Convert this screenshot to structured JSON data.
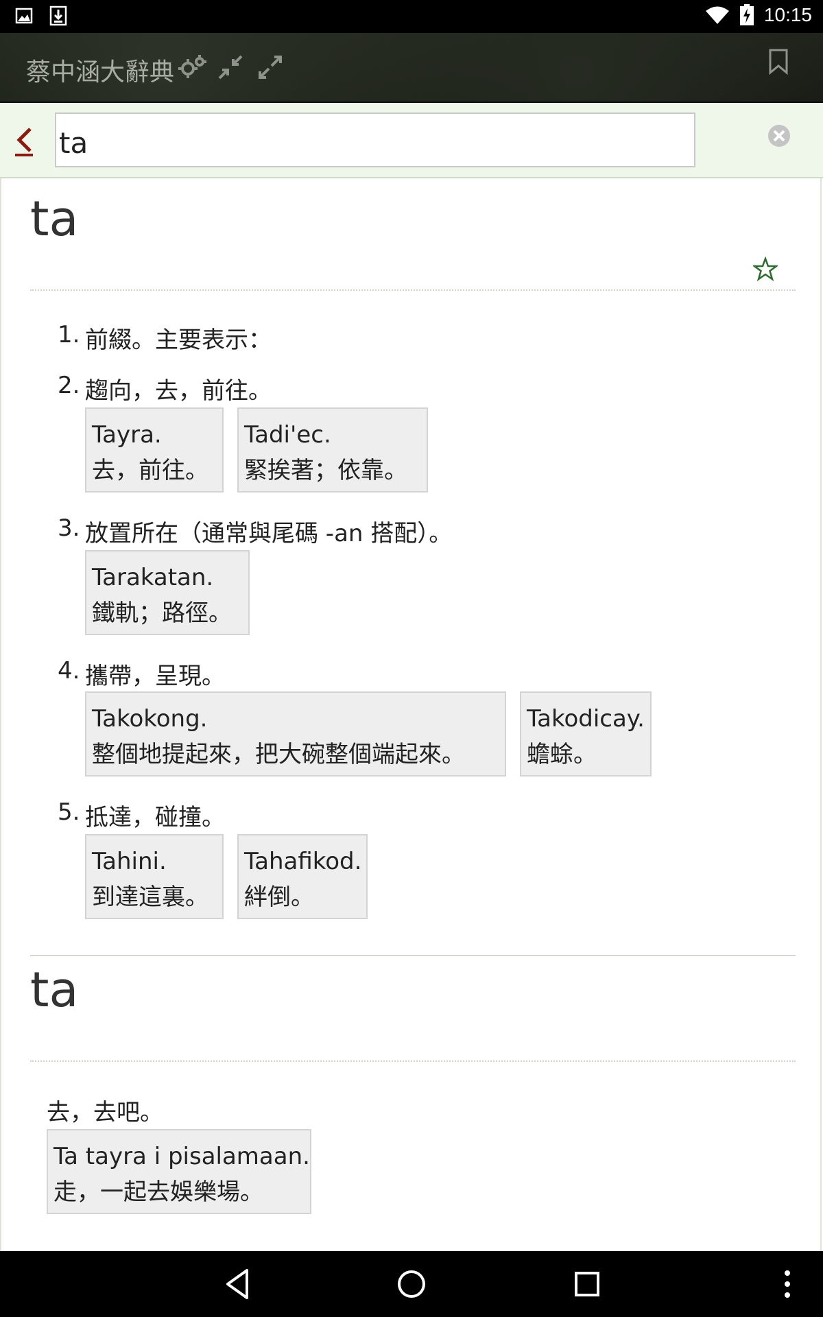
{
  "status_bar": {
    "time": "10:15",
    "icons": [
      "image-icon",
      "download-icon",
      "wifi-icon",
      "battery-charging-icon"
    ]
  },
  "app_bar": {
    "title": "蔡中涵大辭典",
    "icons": [
      "settings-icon",
      "collapse-icon",
      "expand-icon",
      "bookmark-icon"
    ]
  },
  "search": {
    "value": "ta",
    "back_icon": "back-chevron-icon",
    "clear_icon": "clear-icon"
  },
  "entries": [
    {
      "headword": "ta",
      "star_icon": "star-outline-icon",
      "definitions": [
        {
          "num": "1.",
          "text": "前綴。主要表示：",
          "examples": []
        },
        {
          "num": "2.",
          "text": "趨向，去，前往。",
          "examples": [
            {
              "src": "Tayra.",
              "tr": "去，前往。"
            },
            {
              "src": "Tadi'ec.",
              "tr": "緊挨著；依靠。"
            }
          ]
        },
        {
          "num": "3.",
          "text": "放置所在（通常與尾碼 -an 搭配）。",
          "examples": [
            {
              "src": "Tarakatan.",
              "tr": "鐵軌；路徑。"
            }
          ]
        },
        {
          "num": "4.",
          "text": "攜帶，呈現。",
          "examples": [
            {
              "src": "Takokong.",
              "tr": "整個地提起來，把大碗整個端起來。"
            },
            {
              "src": "Takodicay.",
              "tr": "蟾蜍。"
            }
          ]
        },
        {
          "num": "5.",
          "text": "抵達，碰撞。",
          "examples": [
            {
              "src": "Tahini.",
              "tr": "到達這裏。"
            },
            {
              "src": "Tahafikod.",
              "tr": "絆倒。"
            }
          ]
        }
      ]
    },
    {
      "headword": "ta",
      "definition": "去，去吧。",
      "examples": [
        {
          "src": "Ta tayra i pisalamaan.",
          "tr": "走，一起去娛樂場。"
        }
      ]
    }
  ],
  "nav_bar": {
    "icons": [
      "back-triangle-icon",
      "home-circle-icon",
      "recents-square-icon",
      "overflow-menu-icon"
    ]
  },
  "colors": {
    "accent_red": "#8b1a10",
    "star_green": "#2e6b2e",
    "search_bg": "#eef7e9",
    "example_bg": "#eeeeee"
  }
}
